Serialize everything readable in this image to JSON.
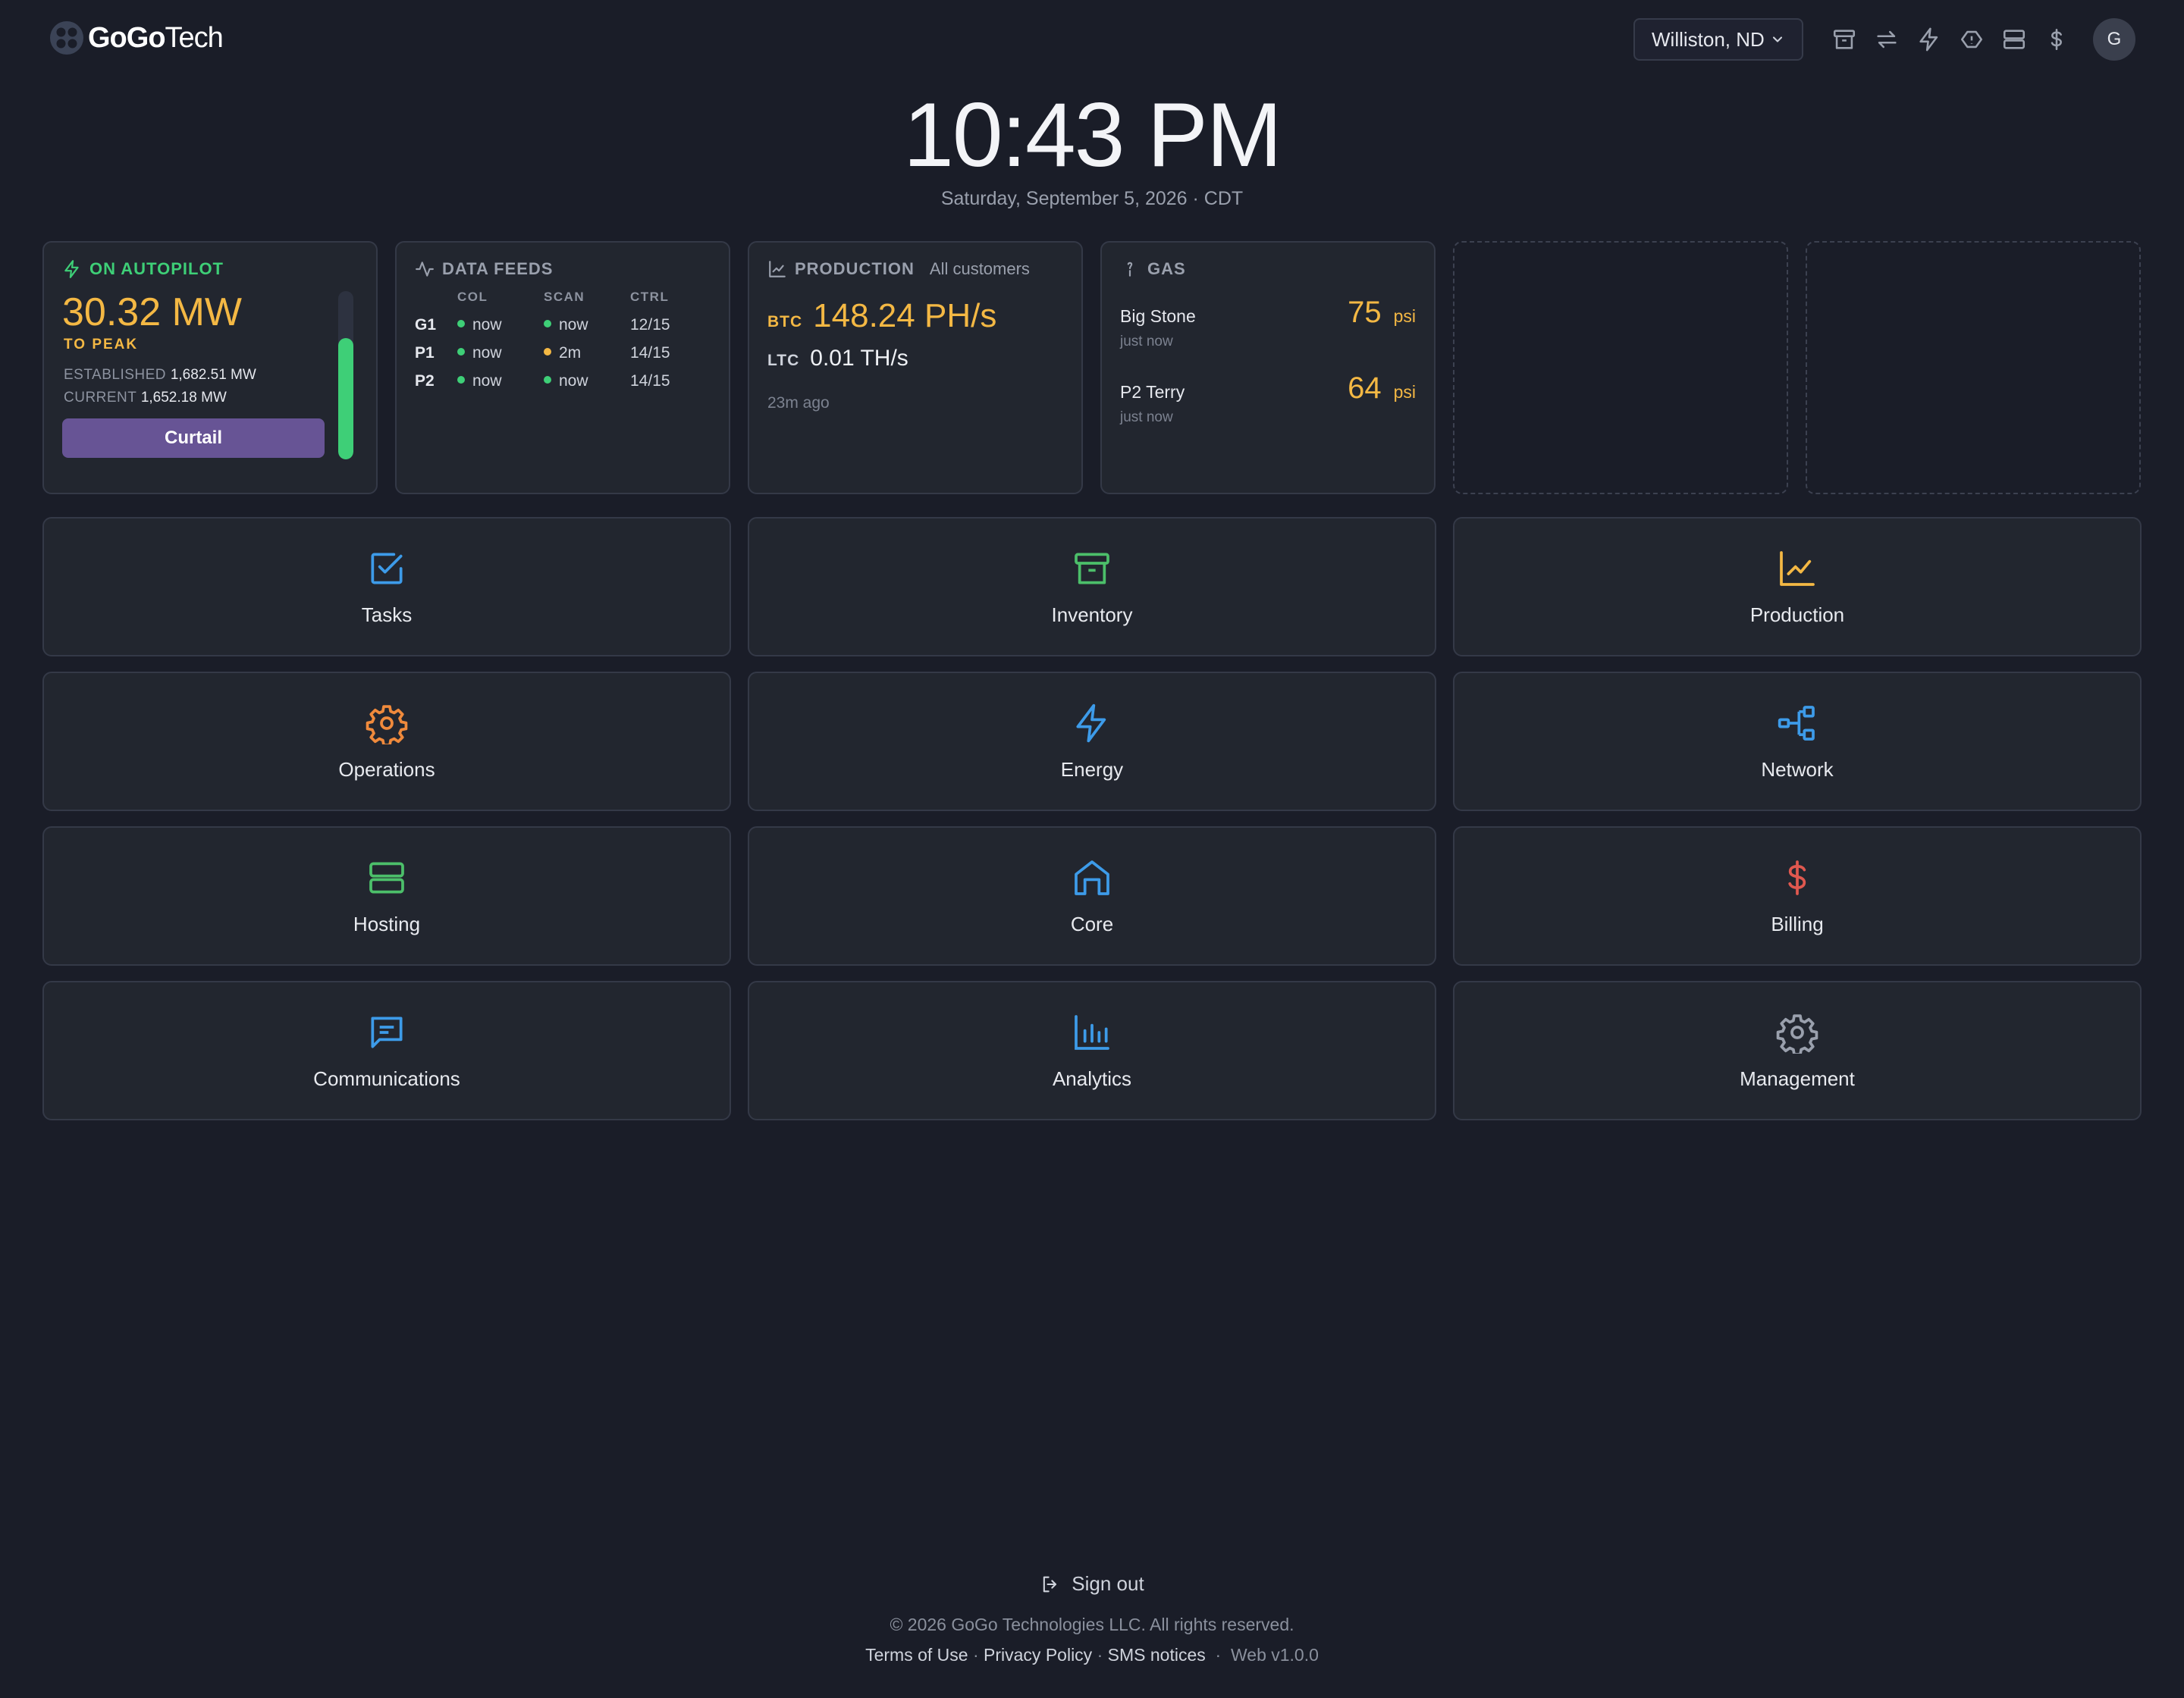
{
  "brand": {
    "name_bold": "GoGo",
    "name_light": "Tech"
  },
  "header": {
    "location": "Williston, ND",
    "avatar_initial": "G",
    "icons": [
      "archive-icon",
      "swap-icon",
      "bolt-icon",
      "ticket-icon",
      "server-icon",
      "dollar-icon"
    ]
  },
  "clock": {
    "time": "10:43 PM",
    "date": "Saturday, September 5, 2026 · CDT"
  },
  "autopilot": {
    "title": "ON AUTOPILOT",
    "value": "30.32 MW",
    "value_sub": "TO PEAK",
    "established_label": "ESTABLISHED",
    "established_value": "1,682.51 MW",
    "current_label": "CURRENT",
    "current_value": "1,652.18 MW",
    "button": "Curtail",
    "level_percent": 72,
    "accent": "#3ecf77"
  },
  "data_feeds": {
    "title": "DATA FEEDS",
    "columns": [
      "COL",
      "SCAN",
      "CTRL"
    ],
    "rows": [
      {
        "site": "G1",
        "col": "now",
        "col_status": "ok",
        "scan": "now",
        "scan_status": "ok",
        "ctrl": "12/15"
      },
      {
        "site": "P1",
        "col": "now",
        "col_status": "ok",
        "scan": "2m",
        "scan_status": "warn",
        "ctrl": "14/15"
      },
      {
        "site": "P2",
        "col": "now",
        "col_status": "ok",
        "scan": "now",
        "scan_status": "ok",
        "ctrl": "14/15"
      }
    ],
    "status_colors": {
      "ok": "#3ecf77",
      "warn": "#f4b844"
    }
  },
  "production": {
    "title": "PRODUCTION",
    "scope": "All customers",
    "btc_label": "BTC",
    "btc_value": "148.24 PH/s",
    "ltc_label": "LTC",
    "ltc_value": "0.01 TH/s",
    "updated": "23m ago"
  },
  "gas": {
    "title": "GAS",
    "sites": [
      {
        "name": "Big Stone",
        "time": "just now",
        "value": "75",
        "unit": "psi"
      },
      {
        "name": "P2 Terry",
        "time": "just now",
        "value": "64",
        "unit": "psi"
      }
    ]
  },
  "tiles": [
    {
      "label": "Tasks",
      "icon": "checkbox-icon",
      "color": "#3d9be9"
    },
    {
      "label": "Inventory",
      "icon": "archive-icon",
      "color": "#4cbf6a"
    },
    {
      "label": "Production",
      "icon": "line-chart-icon",
      "color": "#f4b844"
    },
    {
      "label": "Operations",
      "icon": "gear-icon",
      "color": "#f08a3c"
    },
    {
      "label": "Energy",
      "icon": "bolt-icon",
      "color": "#3d9be9"
    },
    {
      "label": "Network",
      "icon": "network-icon",
      "color": "#3d9be9"
    },
    {
      "label": "Hosting",
      "icon": "server-icon",
      "color": "#4cbf6a"
    },
    {
      "label": "Core",
      "icon": "home-icon",
      "color": "#3d9be9"
    },
    {
      "label": "Billing",
      "icon": "dollar-icon",
      "color": "#e0584f"
    },
    {
      "label": "Communications",
      "icon": "message-icon",
      "color": "#3d9be9"
    },
    {
      "label": "Analytics",
      "icon": "bar-chart-icon",
      "color": "#3d9be9"
    },
    {
      "label": "Management",
      "icon": "gear-icon",
      "color": "#9aa0ad"
    }
  ],
  "footer": {
    "sign_out": "Sign out",
    "copyright": "© 2026 GoGo Technologies LLC. All rights reserved.",
    "links": [
      "Terms of Use",
      "Privacy Policy",
      "SMS notices"
    ],
    "version": "Web v1.0.0"
  }
}
